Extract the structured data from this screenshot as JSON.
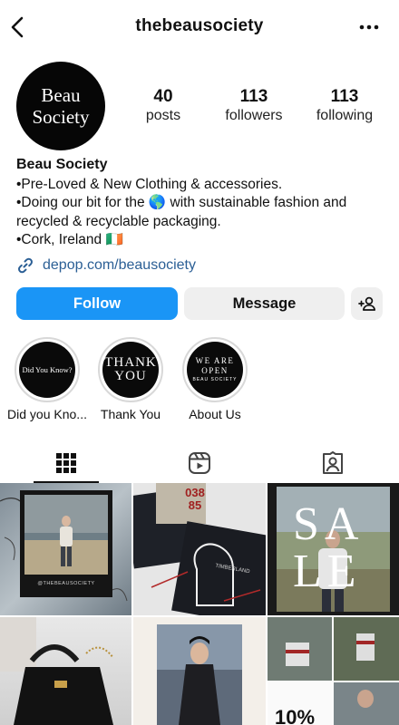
{
  "header": {
    "username": "thebeausociety"
  },
  "avatar": {
    "line1": "Beau",
    "line2": "Society"
  },
  "stats": [
    {
      "value": "40",
      "label": "posts"
    },
    {
      "value": "113",
      "label": "followers"
    },
    {
      "value": "113",
      "label": "following"
    }
  ],
  "bio": {
    "name": "Beau Society",
    "line1": "•Pre-Loved & New Clothing & accessories.",
    "line2_before": "•Doing our bit for the ",
    "line2_emoji": "🌎",
    "line2_after": " with sustainable fashion and",
    "line3": "recycled & recyclable packaging.",
    "line4": "•Cork, Ireland ",
    "line4_flag": "🇮🇪",
    "link": "depop.com/beausociety"
  },
  "buttons": {
    "follow": "Follow",
    "message": "Message"
  },
  "highlights": [
    {
      "label": "Did you Kno...",
      "cover_text": "Did You Know?"
    },
    {
      "label": "Thank You",
      "cover_line1": "THANK",
      "cover_line2": "YOU"
    },
    {
      "label": "About Us",
      "cover_line1": "WE ARE",
      "cover_line2": "OPEN",
      "cover_line3": "BEAU SOCIETY"
    }
  ],
  "grid": {
    "tile1_caption": "@THEBEAUSOCIETY",
    "tile2_tag1": "038",
    "tile2_tag2": "85",
    "tile2_text": "TIMBERLAND",
    "tile3_letters": [
      "SA",
      "LE"
    ],
    "tile6_text": "10%"
  },
  "colors": {
    "follow_button": "#1a95f6",
    "link": "#2b5f95",
    "secondary_button": "#efefef"
  }
}
